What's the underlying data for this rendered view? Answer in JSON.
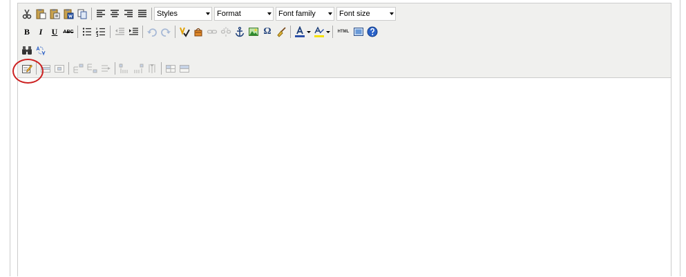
{
  "toolbar": {
    "row1": {
      "styles_label": "Styles",
      "format_label": "Format",
      "font_family_label": "Font family",
      "font_size_label": "Font size"
    },
    "row2": {
      "bold": "B",
      "italic": "I",
      "underline": "U",
      "strikethrough": "ABC",
      "html": "HTML",
      "omega": "Ω"
    }
  },
  "colors": {
    "toolbar_bg": "#f0f0ee",
    "border": "#cccccc",
    "highlight": "#cc1f1f",
    "text_color_swatch": "#2a4ea8",
    "bg_color_swatch": "#f5e000"
  }
}
